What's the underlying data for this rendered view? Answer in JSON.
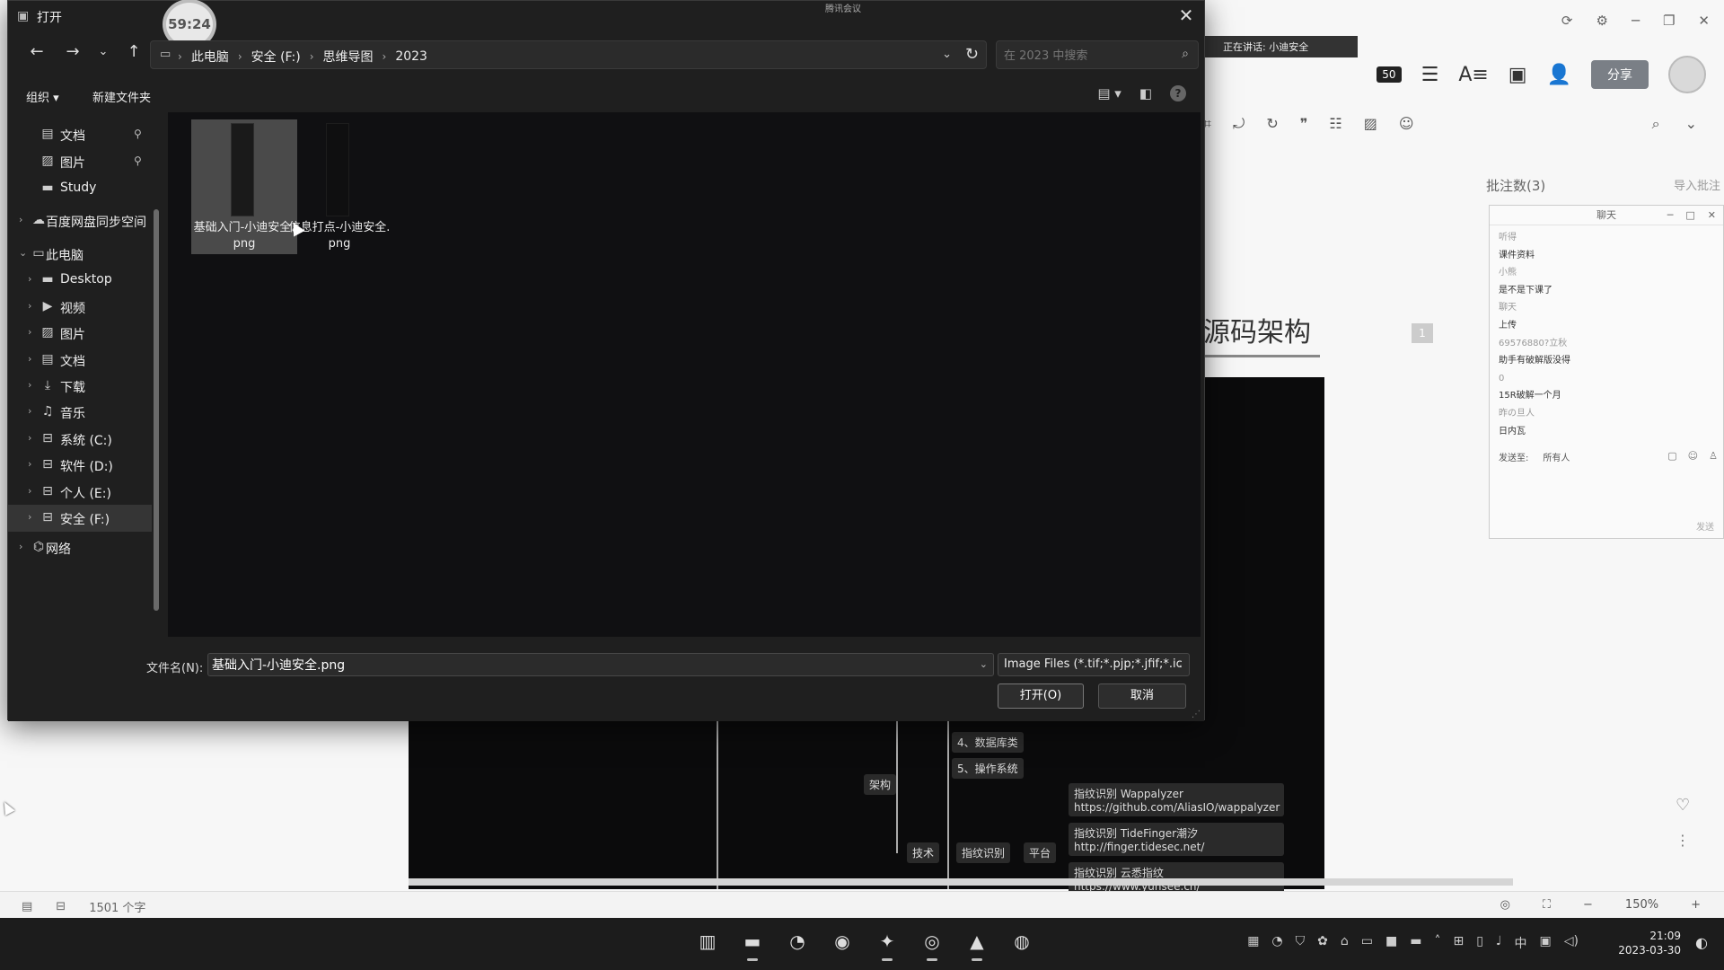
{
  "dialog": {
    "title": "打开",
    "timer": "59:24",
    "meeting_label": "腾讯会议",
    "breadcrumbs": [
      "此电脑",
      "安全 (F:)",
      "思维导图",
      "2023"
    ],
    "search_placeholder": "在 2023 中搜索",
    "organize_label": "组织",
    "new_folder_label": "新建文件夹",
    "nav_items": [
      {
        "label": "文档",
        "icon": "document-icon",
        "pinned": true,
        "expandable": false,
        "indent": 1
      },
      {
        "label": "图片",
        "icon": "picture-icon",
        "pinned": true,
        "expandable": false,
        "indent": 1
      },
      {
        "label": "Study",
        "icon": "folder-icon",
        "pinned": false,
        "expandable": false,
        "indent": 1
      },
      {
        "label": "百度网盘同步空间",
        "icon": "cloud-folder-icon",
        "pinned": false,
        "expandable": true,
        "indent": 0
      },
      {
        "label": "此电脑",
        "icon": "computer-icon",
        "pinned": false,
        "expandable": true,
        "expanded": true,
        "indent": 0
      },
      {
        "label": "Desktop",
        "icon": "folder-icon",
        "pinned": false,
        "expandable": true,
        "indent": 1
      },
      {
        "label": "视频",
        "icon": "video-icon",
        "pinned": false,
        "expandable": true,
        "indent": 1
      },
      {
        "label": "图片",
        "icon": "picture-icon",
        "pinned": false,
        "expandable": true,
        "indent": 1
      },
      {
        "label": "文档",
        "icon": "document-icon",
        "pinned": false,
        "expandable": true,
        "indent": 1
      },
      {
        "label": "下载",
        "icon": "download-icon",
        "pinned": false,
        "expandable": true,
        "indent": 1
      },
      {
        "label": "音乐",
        "icon": "music-icon",
        "pinned": false,
        "expandable": true,
        "indent": 1
      },
      {
        "label": "系统 (C:)",
        "icon": "drive-icon",
        "pinned": false,
        "expandable": true,
        "indent": 1
      },
      {
        "label": "软件 (D:)",
        "icon": "drive-icon",
        "pinned": false,
        "expandable": true,
        "indent": 1
      },
      {
        "label": "个人 (E:)",
        "icon": "drive-icon",
        "pinned": false,
        "expandable": true,
        "indent": 1
      },
      {
        "label": "安全 (F:)",
        "icon": "drive-icon",
        "pinned": false,
        "expandable": true,
        "indent": 1,
        "selected": true
      },
      {
        "label": "网络",
        "icon": "network-icon",
        "pinned": false,
        "expandable": true,
        "indent": 0
      }
    ],
    "files": [
      {
        "name": "基础入门-小迪安全.png",
        "selected": true
      },
      {
        "name": "信息打点-小迪安全.png",
        "selected": false
      }
    ],
    "filename_label": "文件名(N):",
    "filename_value": "基础入门-小迪安全.png",
    "filetype_value": "Image Files (*.tif;*.pjp;*.jfif;*.ic",
    "open_label": "打开(O)",
    "cancel_label": "取消"
  },
  "background": {
    "share_label": "分享",
    "counter": "50",
    "meeting_tooltip": "正在讲话: 小迪安全",
    "heading": "源码架构",
    "heading_badge": "1",
    "comment_count": "批注数(3)",
    "comment_import": "导入批注",
    "chat_title": "聊天",
    "chat_messages": [
      "听得",
      "课件资料",
      "小熊",
      "是不是下课了",
      "聊天",
      "上传",
      "69576880?立秋",
      "助手有破解版没得",
      "0",
      "15R破解一个月",
      "昨の旦人",
      "日内瓦"
    ],
    "send_label": "发送至:",
    "send_target": "所有人",
    "send_button": "发送",
    "mindmap_nodes": [
      "4、数据库类",
      "5、操作系统",
      "架构",
      "技术",
      "指纹识别",
      "平台",
      "指纹识别 Wappalyzer https://github.com/AliasIO/wappalyzer",
      "指纹识别 TideFinger潮汐 http://finger.tidesec.net/",
      "指纹识别 云悉指纹 https://www.yunsee.cn/"
    ],
    "word_count": "1501 个字",
    "zoom": "150%"
  },
  "taskbar": {
    "time": "21:09",
    "date": "2023-03-30",
    "ime": "中",
    "apps": [
      "file-manager-icon",
      "folder-icon",
      "edge-icon",
      "chrome-icon",
      "xmind-icon",
      "wechat-icon",
      "photos-icon",
      "meeting-icon"
    ]
  }
}
